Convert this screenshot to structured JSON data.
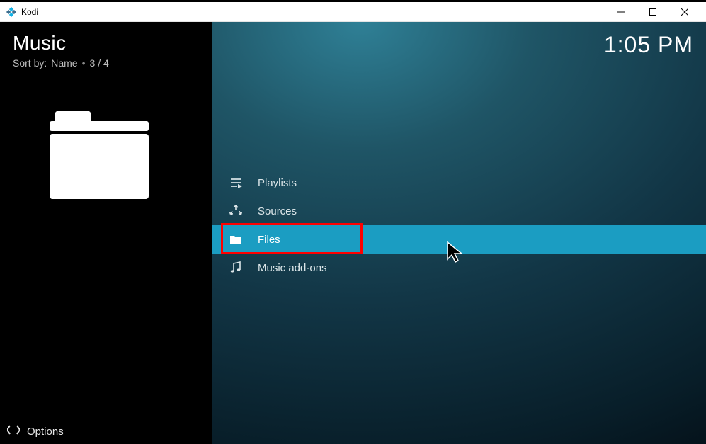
{
  "window": {
    "title": "Kodi"
  },
  "header": {
    "title": "Music",
    "sort_label": "Sort by:",
    "sort_value": "Name",
    "index": "3 / 4"
  },
  "clock": "1:05 PM",
  "menu": {
    "items": [
      {
        "icon": "playlist-icon",
        "label": "Playlists",
        "selected": false
      },
      {
        "icon": "sources-icon",
        "label": "Sources",
        "selected": false
      },
      {
        "icon": "folder-icon",
        "label": "Files",
        "selected": true
      },
      {
        "icon": "music-note-icon",
        "label": "Music add-ons",
        "selected": false
      }
    ]
  },
  "footer": {
    "options_label": "Options"
  }
}
